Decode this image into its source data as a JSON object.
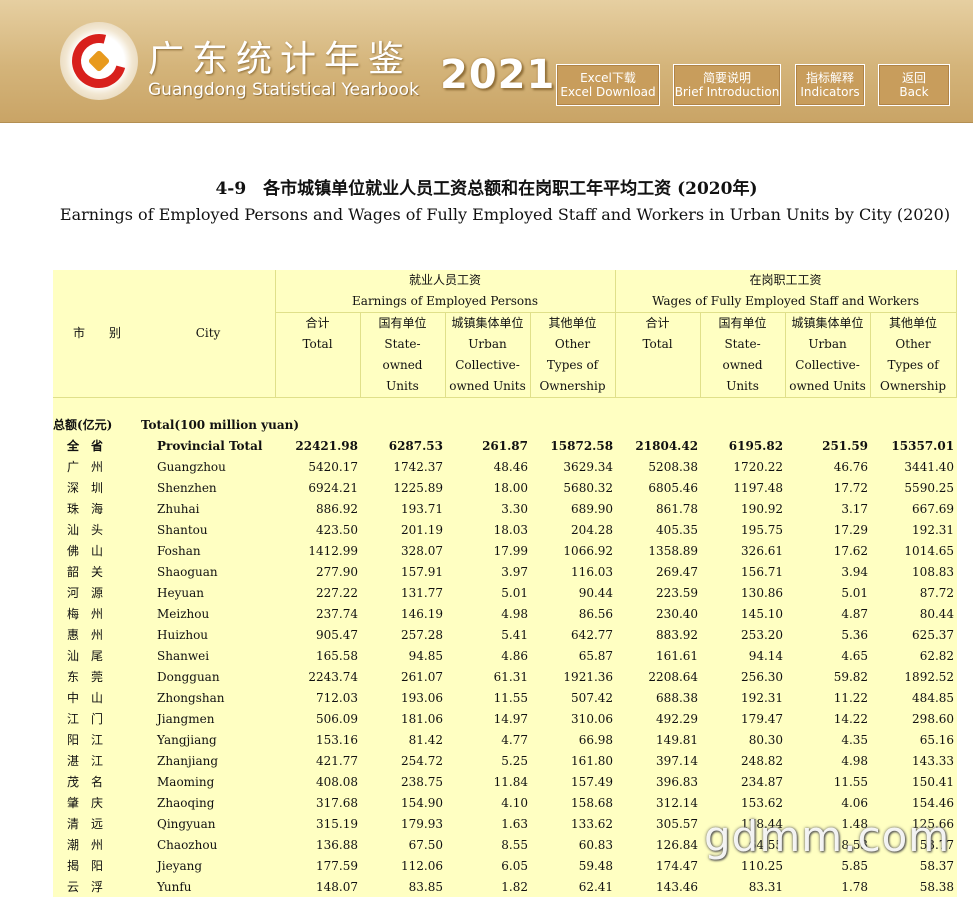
{
  "header": {
    "title_cn": "广东统计年鉴",
    "title_en": "Guangdong Statistical Yearbook",
    "year": "2021",
    "buttons": [
      {
        "cn": "Excel下载",
        "en": "Excel Download"
      },
      {
        "cn": "简要说明",
        "en": "Brief Introduction"
      },
      {
        "cn": "指标解释",
        "en": "Indicators"
      },
      {
        "cn": "返回",
        "en": "Back"
      }
    ]
  },
  "page_title": {
    "cn": "4-9　各市城镇单位就业人员工资总额和在岗职工年平均工资 (2020年)",
    "en": "Earnings of Employed Persons and Wages of Fully Employed Staff and Workers  in Urban Units by City (2020)"
  },
  "table": {
    "col_city_cn": "市　　别",
    "col_city_en": "City",
    "group1_cn": "就业人员工资",
    "group1_en": "Earnings of Employed Persons",
    "group2_cn": "在岗职工工资",
    "group2_en": "Wages of Fully Employed Staff and Workers",
    "sub_cols": [
      {
        "cn": "合计",
        "en1": "Total",
        "en2": "",
        "en3": ""
      },
      {
        "cn": "国有单位",
        "en1": "State-",
        "en2": "owned",
        "en3": "Units"
      },
      {
        "cn": "城镇集体单位",
        "en1": "Urban",
        "en2": "Collective-",
        "en3": "owned Units"
      },
      {
        "cn": "其他单位",
        "en1": "Other",
        "en2": "Types of",
        "en3": "Ownership"
      }
    ],
    "section_cn": "总额(亿元)",
    "section_en": "Total(100 million yuan)",
    "rows": [
      {
        "cn": "全省",
        "en": "Provincial Total",
        "v": [
          "22421.98",
          "6287.53",
          "261.87",
          "15872.58",
          "21804.42",
          "6195.82",
          "251.59",
          "15357.01"
        ]
      },
      {
        "cn": "广州",
        "en": "Guangzhou",
        "v": [
          "5420.17",
          "1742.37",
          "48.46",
          "3629.34",
          "5208.38",
          "1720.22",
          "46.76",
          "3441.40"
        ]
      },
      {
        "cn": "深圳",
        "en": "Shenzhen",
        "v": [
          "6924.21",
          "1225.89",
          "18.00",
          "5680.32",
          "6805.46",
          "1197.48",
          "17.72",
          "5590.25"
        ]
      },
      {
        "cn": "珠海",
        "en": "Zhuhai",
        "v": [
          "886.92",
          "193.71",
          "3.30",
          "689.90",
          "861.78",
          "190.92",
          "3.17",
          "667.69"
        ]
      },
      {
        "cn": "汕头",
        "en": "Shantou",
        "v": [
          "423.50",
          "201.19",
          "18.03",
          "204.28",
          "405.35",
          "195.75",
          "17.29",
          "192.31"
        ]
      },
      {
        "cn": "佛山",
        "en": "Foshan",
        "v": [
          "1412.99",
          "328.07",
          "17.99",
          "1066.92",
          "1358.89",
          "326.61",
          "17.62",
          "1014.65"
        ]
      },
      {
        "cn": "韶关",
        "en": "Shaoguan",
        "v": [
          "277.90",
          "157.91",
          "3.97",
          "116.03",
          "269.47",
          "156.71",
          "3.94",
          "108.83"
        ]
      },
      {
        "cn": "河源",
        "en": "Heyuan",
        "v": [
          "227.22",
          "131.77",
          "5.01",
          "90.44",
          "223.59",
          "130.86",
          "5.01",
          "87.72"
        ]
      },
      {
        "cn": "梅州",
        "en": "Meizhou",
        "v": [
          "237.74",
          "146.19",
          "4.98",
          "86.56",
          "230.40",
          "145.10",
          "4.87",
          "80.44"
        ]
      },
      {
        "cn": "惠州",
        "en": "Huizhou",
        "v": [
          "905.47",
          "257.28",
          "5.41",
          "642.77",
          "883.92",
          "253.20",
          "5.36",
          "625.37"
        ]
      },
      {
        "cn": "汕尾",
        "en": "Shanwei",
        "v": [
          "165.58",
          "94.85",
          "4.86",
          "65.87",
          "161.61",
          "94.14",
          "4.65",
          "62.82"
        ]
      },
      {
        "cn": "东莞",
        "en": "Dongguan",
        "v": [
          "2243.74",
          "261.07",
          "61.31",
          "1921.36",
          "2208.64",
          "256.30",
          "59.82",
          "1892.52"
        ]
      },
      {
        "cn": "中山",
        "en": "Zhongshan",
        "v": [
          "712.03",
          "193.06",
          "11.55",
          "507.42",
          "688.38",
          "192.31",
          "11.22",
          "484.85"
        ]
      },
      {
        "cn": "江门",
        "en": "Jiangmen",
        "v": [
          "506.09",
          "181.06",
          "14.97",
          "310.06",
          "492.29",
          "179.47",
          "14.22",
          "298.60"
        ]
      },
      {
        "cn": "阳江",
        "en": "Yangjiang",
        "v": [
          "153.16",
          "81.42",
          "4.77",
          "66.98",
          "149.81",
          "80.30",
          "4.35",
          "65.16"
        ]
      },
      {
        "cn": "湛江",
        "en": "Zhanjiang",
        "v": [
          "421.77",
          "254.72",
          "5.25",
          "161.80",
          "397.14",
          "248.82",
          "4.98",
          "143.33"
        ]
      },
      {
        "cn": "茂名",
        "en": "Maoming",
        "v": [
          "408.08",
          "238.75",
          "11.84",
          "157.49",
          "396.83",
          "234.87",
          "11.55",
          "150.41"
        ]
      },
      {
        "cn": "肇庆",
        "en": "Zhaoqing",
        "v": [
          "317.68",
          "154.90",
          "4.10",
          "158.68",
          "312.14",
          "153.62",
          "4.06",
          "154.46"
        ]
      },
      {
        "cn": "清远",
        "en": "Qingyuan",
        "v": [
          "315.19",
          "179.93",
          "1.63",
          "133.62",
          "305.57",
          "178.44",
          "1.48",
          "125.66"
        ]
      },
      {
        "cn": "潮州",
        "en": "Chaozhou",
        "v": [
          "136.88",
          "67.50",
          "8.55",
          "60.83",
          "126.84",
          "64.55",
          "8.53",
          "53.77"
        ]
      },
      {
        "cn": "揭阳",
        "en": "Jieyang",
        "v": [
          "177.59",
          "112.06",
          "6.05",
          "59.48",
          "174.47",
          "110.25",
          "5.85",
          "58.37"
        ]
      },
      {
        "cn": "云浮",
        "en": "Yunfu",
        "v": [
          "148.07",
          "83.85",
          "1.82",
          "62.41",
          "143.46",
          "83.31",
          "1.78",
          "58.38"
        ]
      }
    ]
  },
  "watermark": "gdmm.com"
}
